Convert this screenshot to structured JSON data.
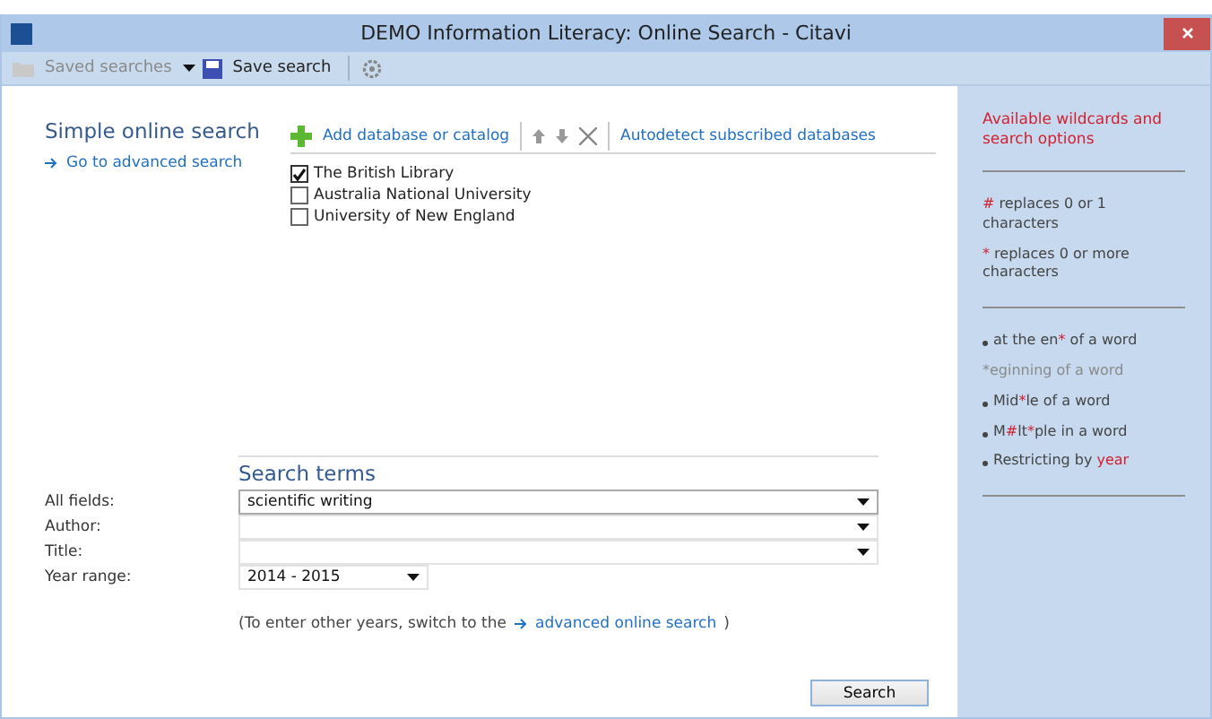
{
  "window": {
    "title": "DEMO Information Literacy: Online Search - Citavi"
  },
  "toolbar": {
    "saved_searches": "Saved searches",
    "save_search": "Save search"
  },
  "left": {
    "heading": "Simple online search",
    "advanced_link": "Go to advanced search"
  },
  "databases": {
    "add": "Add database or catalog",
    "autodetect": "Autodetect subscribed databases",
    "items": [
      {
        "name": "The British Library",
        "checked": true
      },
      {
        "name": "Australia National University",
        "checked": false
      },
      {
        "name": "University of New England",
        "checked": false
      }
    ]
  },
  "search_terms": {
    "heading": "Search terms",
    "fields": [
      {
        "label": "All fields:",
        "value": "scientific writing"
      },
      {
        "label": "Author:"
      },
      {
        "label": "Title:"
      }
    ],
    "year_range": {
      "label": "Year range:",
      "value": "2014 - 2015"
    },
    "note_before": "(To enter other years, switch to the",
    "note_link": "advanced online search",
    "note_after": ")",
    "search_button": "Search"
  },
  "help": {
    "title": "Available wildcards and search options",
    "groups": [
      [
        {
          "kind": "plain",
          "parts": [
            {
              "text": "#",
              "highlight": true
            },
            {
              "text": " replaces 0 or 1 characters",
              "highlight": false
            }
          ]
        },
        {
          "kind": "plain",
          "parts": [
            {
              "text": "*",
              "highlight": true
            },
            {
              "text": " replaces 0 or more characters",
              "highlight": false
            }
          ]
        }
      ],
      [
        {
          "kind": "bullet",
          "parts": [
            {
              "text": "at the en",
              "highlight": false
            },
            {
              "text": "*",
              "highlight": true
            },
            {
              "text": " of a word",
              "highlight": false
            }
          ]
        },
        {
          "kind": "muted",
          "parts": [
            {
              "text": "*eginning of a word",
              "highlight": false
            }
          ]
        },
        {
          "kind": "bullet",
          "parts": [
            {
              "text": "Mid",
              "highlight": false
            },
            {
              "text": "*",
              "highlight": true
            },
            {
              "text": "le of a word",
              "highlight": false
            }
          ]
        },
        {
          "kind": "bullet",
          "parts": [
            {
              "text": "M",
              "highlight": false
            },
            {
              "text": "#",
              "highlight": true
            },
            {
              "text": "lt",
              "highlight": false
            },
            {
              "text": "*",
              "highlight": true
            },
            {
              "text": "ple in a word",
              "highlight": false
            }
          ]
        },
        {
          "kind": "bullet",
          "parts": [
            {
              "text": "Restricting by ",
              "highlight": false
            },
            {
              "text": "year",
              "highlight": true
            }
          ]
        }
      ]
    ]
  }
}
